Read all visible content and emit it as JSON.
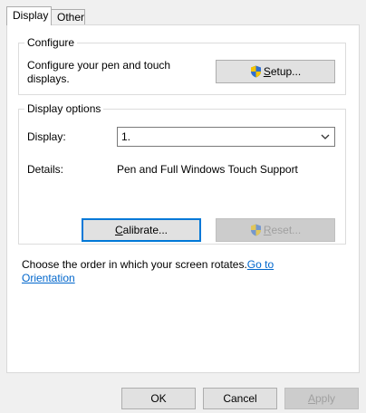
{
  "tabs": [
    {
      "label": "Display",
      "active": true
    },
    {
      "label": "Other",
      "active": false
    }
  ],
  "configure": {
    "title": "Configure",
    "description_line1": "Configure your pen and touch",
    "description_line2": "displays.",
    "setup_prefix": "S",
    "setup_rest": "etup..."
  },
  "display_options": {
    "title": "Display options",
    "display_label": "Display:",
    "display_value": "1.",
    "details_label": "Details:",
    "details_value": "Pen and Full Windows Touch Support",
    "calibrate_prefix": "C",
    "calibrate_rest": "alibrate...",
    "reset_prefix": "R",
    "reset_rest": "eset..."
  },
  "rotation": {
    "text": "Choose the order in which your screen rotates.",
    "link_line1": "Go to",
    "link_line2": "Orientation"
  },
  "footer": {
    "ok_label": "OK",
    "cancel_label": "Cancel",
    "apply_prefix": "A",
    "apply_rest": "pply"
  },
  "colors": {
    "shield_blue": "#2f6fd0",
    "shield_yellow": "#f5c400",
    "link": "#0066cc",
    "focus": "#0078d7"
  }
}
